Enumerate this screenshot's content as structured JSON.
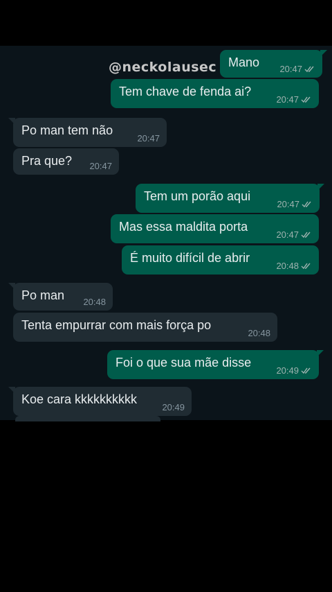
{
  "watermark": "@neckolausec",
  "messages": [
    {
      "dir": "out",
      "text": "Mano",
      "time": "20:47"
    },
    {
      "dir": "out",
      "text": "Tem chave de fenda ai?",
      "time": "20:47"
    },
    {
      "dir": "in",
      "text": "Po man tem não",
      "time": "20:47"
    },
    {
      "dir": "in",
      "text": "Pra que?",
      "time": "20:47"
    },
    {
      "dir": "out",
      "text": "Tem um porão aqui",
      "time": "20:47"
    },
    {
      "dir": "out",
      "text": "Mas essa maldita porta",
      "time": "20:47"
    },
    {
      "dir": "out",
      "text": "É muito difícil de abrir",
      "time": "20:48"
    },
    {
      "dir": "in",
      "text": "Po man",
      "time": "20:48"
    },
    {
      "dir": "in",
      "text": "Tenta empurrar com mais força po",
      "time": "20:48"
    },
    {
      "dir": "out",
      "text": "Foi o que sua mãe disse",
      "time": "20:49"
    },
    {
      "dir": "in",
      "text": "Koe cara kkkkkkkkkk",
      "time": "20:49"
    }
  ]
}
